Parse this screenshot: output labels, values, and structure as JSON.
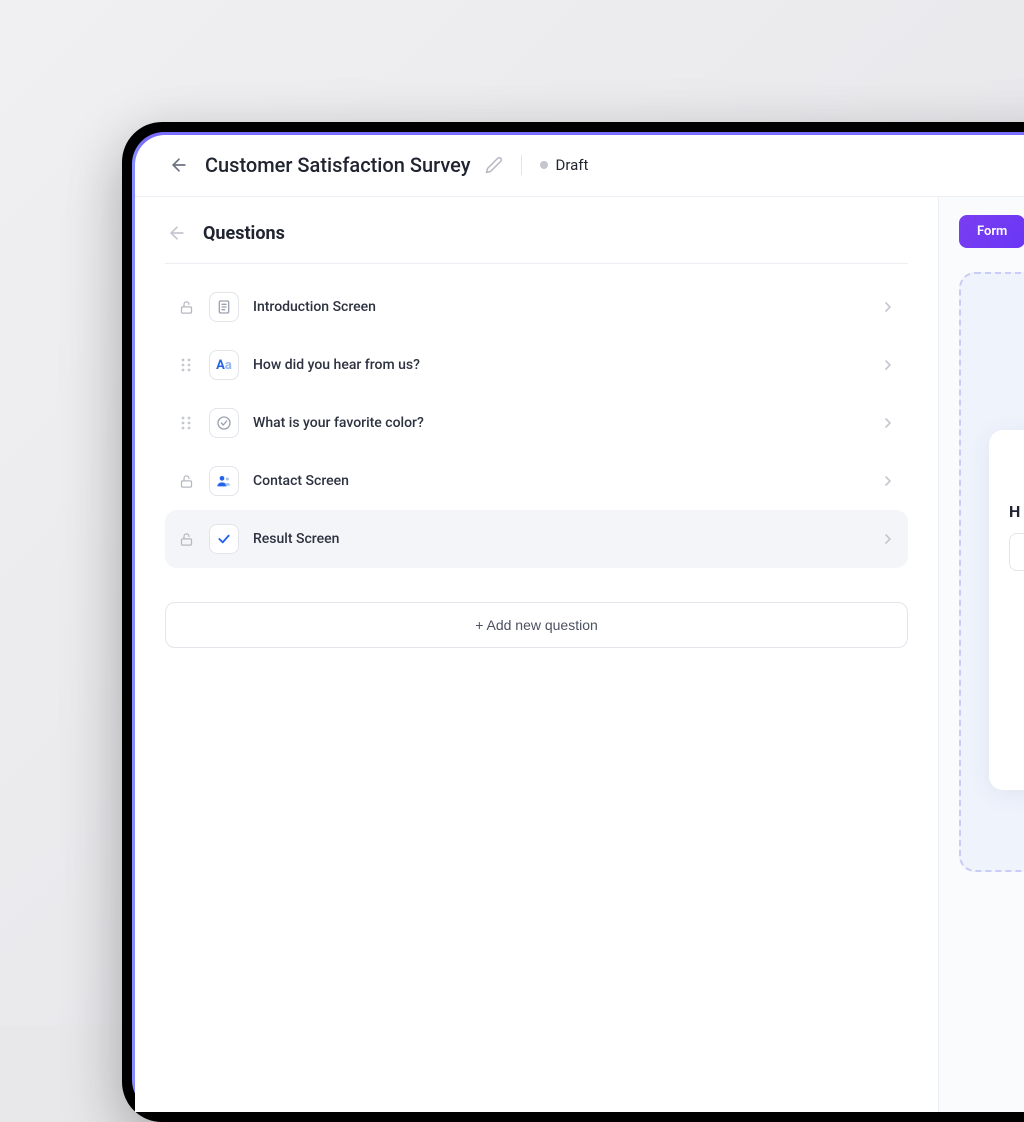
{
  "header": {
    "title": "Customer Satisfaction Survey",
    "status": "Draft"
  },
  "panel": {
    "title": "Questions",
    "add_button_label": "+ Add new question"
  },
  "questions": [
    {
      "label": "Introduction Screen",
      "icon": "document-icon",
      "handle": "lock",
      "selected": false
    },
    {
      "label": "How did you hear from us?",
      "icon": "text-aa-icon",
      "handle": "drag",
      "selected": false
    },
    {
      "label": "What is your favorite color?",
      "icon": "check-circle-icon",
      "handle": "drag",
      "selected": false
    },
    {
      "label": "Contact Screen",
      "icon": "person-icon",
      "handle": "lock",
      "selected": false
    },
    {
      "label": "Result Screen",
      "icon": "check-icon",
      "handle": "lock",
      "selected": true
    }
  ],
  "preview": {
    "tab_label": "Form",
    "heading_fragment": "H"
  }
}
